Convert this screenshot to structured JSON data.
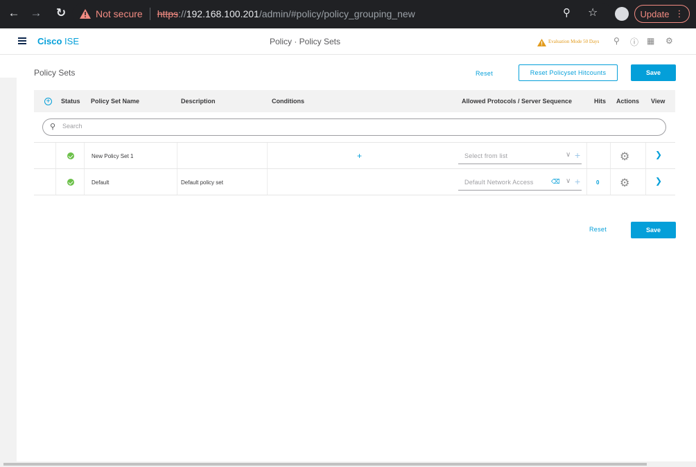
{
  "browser": {
    "not_secure": "Not secure",
    "url_scheme": "https",
    "url_sep": "://",
    "url_host": "192.168.100.201",
    "url_path": "/admin/#policy/policy_grouping_new",
    "update_label": "Update",
    "warn_color": "#f28b82"
  },
  "header": {
    "brand_cisco": "Cisco",
    "brand_ise": "ISE",
    "title": "Policy · Policy Sets",
    "evaluation": "Evaluation Mode 50 Days"
  },
  "page": {
    "title": "Policy Sets",
    "reset_label": "Reset",
    "reset_hitcounts_label": "Reset Policyset Hitcounts",
    "save_label": "Save",
    "bottom_reset_label": "Reset",
    "bottom_save_label": "Save"
  },
  "table": {
    "columns": {
      "status": "Status",
      "name": "Policy Set Name",
      "description": "Description",
      "conditions": "Conditions",
      "protocols": "Allowed Protocols / Server Sequence",
      "hits": "Hits",
      "actions": "Actions",
      "view": "View"
    },
    "search_placeholder": "Search",
    "rows": [
      {
        "name": "New Policy Set 1",
        "description": "",
        "protocol": "Select from list",
        "hits": ""
      },
      {
        "name": "Default",
        "description": "Default policy set",
        "protocol": "Default Network Access",
        "hits": "0"
      }
    ]
  },
  "colors": {
    "accent": "#049fd9",
    "status_ok": "#6cc04a",
    "eval_warning": "#e29b1d"
  }
}
